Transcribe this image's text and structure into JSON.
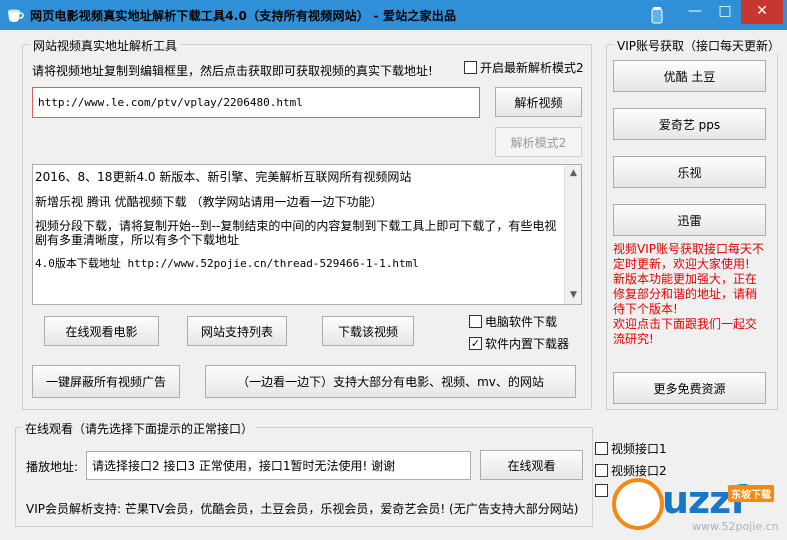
{
  "window": {
    "title": "网页电影视频真实地址解析下载工具4.0（支持所有视频网站） - 爱站之家出品",
    "minimize": "—",
    "maximize": "□",
    "close": "✕"
  },
  "parser": {
    "group_label": "网站视频真实地址解析工具",
    "instruction": "请将视频地址复制到编辑框里，然后点击获取即可获取视频的真实下载地址!",
    "mode2_checkbox": "开启最新解析模式2",
    "url_value": "http://www.le.com/ptv/vplay/2206480.html",
    "parse_button": "解析视频",
    "parse_mode2_button": "解析模式2",
    "log_lines": [
      "2016、8、18更新4.0 新版本、新引擎、完美解析互联网所有视频网站",
      "新增乐视 腾讯 优酷视频下载 （教学网站请用一边看一边下功能）",
      "视频分段下载，请将复制开始--到--复制结束的中间的内容复制到下载工具上即可下载了，有些电视",
      "剧有多重清晰度，所以有多个下载地址",
      "4.0版本下载地址 http://www.52pojie.cn/thread-529466-1-1.html"
    ],
    "watch_online_button": "在线观看电影",
    "site_list_button": "网站支持列表",
    "download_button": "下载该视频",
    "pc_download_checkbox": "电脑软件下载",
    "builtin_download_checkbox": "软件内置下载器",
    "block_ads_button": "一键屏蔽所有视频广告",
    "watch_download_button": "（一边看一边下）支持大部分有电影、视频、mv、的网站"
  },
  "vip": {
    "group_label": "VIP账号获取（接口每天更新）",
    "buttons": [
      "优酷 土豆",
      "爱奇艺 pps",
      "乐视",
      "迅雷"
    ],
    "notice": [
      "视频VIP账号获取接口每天不",
      "定时更新，欢迎大家使用!",
      "新版本功能更加强大，正在",
      "修复部分和谐的地址，请稍",
      "待下个版本!"
    ],
    "invite": [
      "欢迎点击下面跟我们一起交",
      "流研究!"
    ],
    "more_button": "更多免费资源"
  },
  "online": {
    "group_label": "在线观看（请先选择下面提示的正常接口）",
    "play_label": "播放地址:",
    "play_value": "请选择接口2 接口3 正常使用，接口1暂时无法使用! 谢谢",
    "watch_button": "在线观看",
    "interface1": "视频接口1",
    "interface2": "视频接口2",
    "vip_support": "VIP会员解析支持: 芒果TV会员，优酷会员，土豆会员，乐视会员，爱奇艺会员! (无广告支持大部分网站)"
  },
  "watermark": {
    "brand": "uzzf",
    "badge": "东坡下载",
    "site": "www.52pojie.cn"
  },
  "colors": {
    "titlebar": "#2f8fd7",
    "close": "#c7372f",
    "notice_red": "#e60000",
    "url_border": "#e06060"
  }
}
